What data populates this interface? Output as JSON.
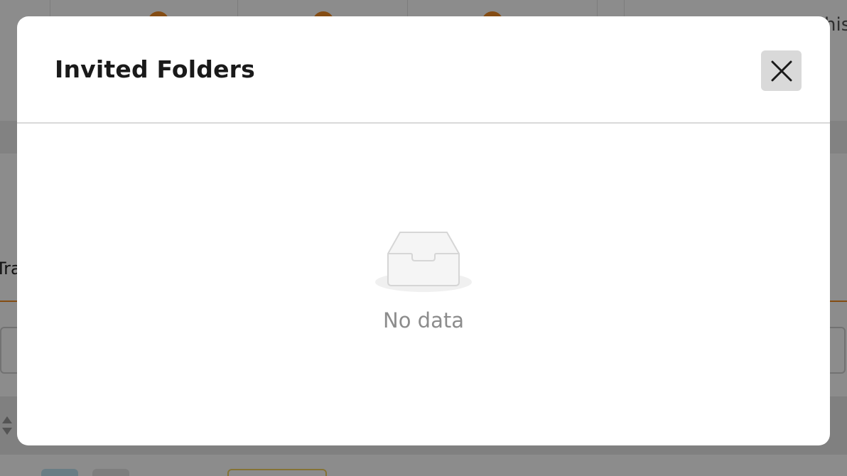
{
  "modal": {
    "title": "Invited Folders",
    "close_icon": "close-icon",
    "empty_state": {
      "icon": "empty-inbox-icon",
      "text": "No data"
    }
  },
  "background": {
    "tab_label_fragment": "Tra",
    "right_text_fragment": "his",
    "accent_color": "#f08a24"
  }
}
